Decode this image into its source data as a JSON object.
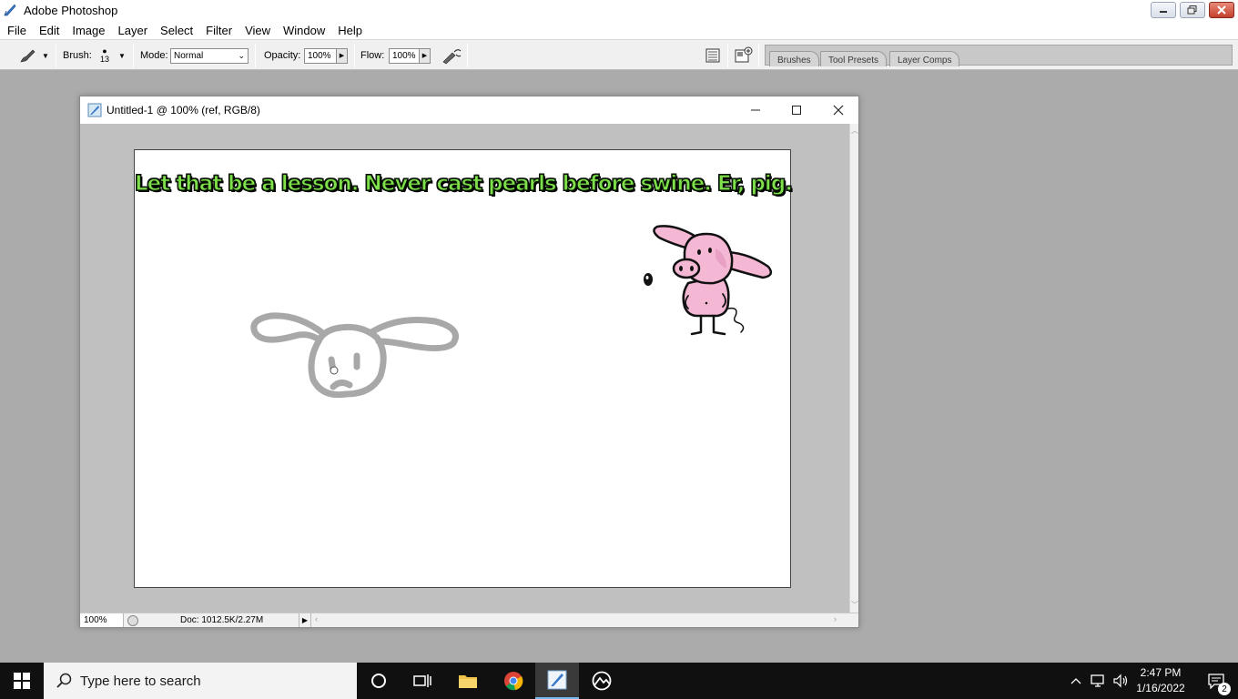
{
  "app": {
    "title": "Adobe Photoshop",
    "window_controls": [
      "minimize",
      "restore",
      "close"
    ]
  },
  "menu": [
    "File",
    "Edit",
    "Image",
    "Layer",
    "Select",
    "Filter",
    "View",
    "Window",
    "Help"
  ],
  "options_bar": {
    "brush_label": "Brush:",
    "brush_size": "13",
    "mode_label": "Mode:",
    "mode_value": "Normal",
    "opacity_label": "Opacity:",
    "opacity_value": "100%",
    "flow_label": "Flow:",
    "flow_value": "100%"
  },
  "palette_well": {
    "tabs": [
      "Brushes",
      "Tool Presets",
      "Layer Comps"
    ]
  },
  "document": {
    "title": "Untitled-1 @ 100% (ref, RGB/8)",
    "caption": "Let that be a lesson. Never cast pearls before swine. Er, pig.",
    "zoom": "100%",
    "doc_info": "Doc: 1012.5K/2.27M"
  },
  "taskbar": {
    "search_placeholder": "Type here to search",
    "apps": [
      "cortana",
      "task-view",
      "file-explorer",
      "chrome",
      "photoshop",
      "photos"
    ],
    "time": "2:47 PM",
    "date": "1/16/2022",
    "notification_count": "2"
  },
  "colors": {
    "caption_fill": "#7ee04a",
    "pig_pink": "#f4b8d4",
    "desktop_gray": "#ababab",
    "taskbar": "#101010"
  }
}
